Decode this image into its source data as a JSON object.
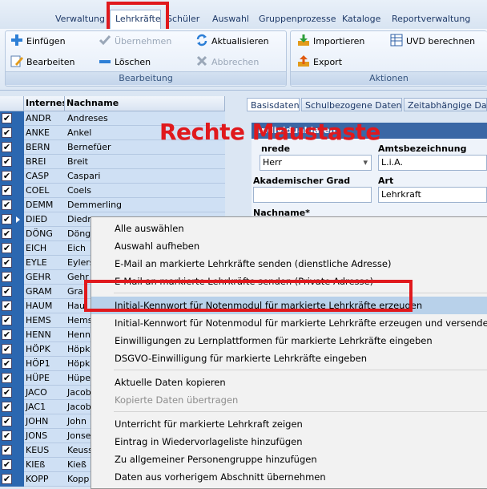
{
  "ribbon_tabs": [
    "Verwaltung",
    "Lehrkräfte",
    "Schüler",
    "Auswahl",
    "Gruppenprozesse",
    "Kataloge",
    "Reportverwaltung"
  ],
  "active_tab": "Lehrkräfte",
  "groups": {
    "bearbeitung": {
      "title": "Bearbeitung",
      "buttons": {
        "einfuegen": "Einfügen",
        "uebernehmen": "Übernehmen",
        "aktualisieren": "Aktualisieren",
        "bearbeiten": "Bearbeiten",
        "loeschen": "Löschen",
        "abbrechen": "Abbrechen"
      }
    },
    "aktionen": {
      "title": "Aktionen",
      "buttons": {
        "importieren": "Importieren",
        "uvd": "UVD berechnen",
        "export": "Export"
      }
    }
  },
  "grid": {
    "columns": [
      "Internes K",
      "Nachname"
    ],
    "rows": [
      {
        "kuerzel": "ANDR",
        "name": "Andreses"
      },
      {
        "kuerzel": "ANKE",
        "name": "Ankel"
      },
      {
        "kuerzel": "BERN",
        "name": "Bernefüer"
      },
      {
        "kuerzel": "BREI",
        "name": "Breit"
      },
      {
        "kuerzel": "CASP",
        "name": "Caspari"
      },
      {
        "kuerzel": "COEL",
        "name": "Coels"
      },
      {
        "kuerzel": "DEMM",
        "name": "Demmerling"
      },
      {
        "kuerzel": "DIED",
        "name": "Diedr"
      },
      {
        "kuerzel": "DÖNG",
        "name": "Döng"
      },
      {
        "kuerzel": "EICH",
        "name": "Eich"
      },
      {
        "kuerzel": "EYLE",
        "name": "Eylers"
      },
      {
        "kuerzel": "GEHR",
        "name": "Gehr"
      },
      {
        "kuerzel": "GRAM",
        "name": "Gra"
      },
      {
        "kuerzel": "HAUM",
        "name": "Hau"
      },
      {
        "kuerzel": "HEMS",
        "name": "Hems"
      },
      {
        "kuerzel": "HENN",
        "name": "Henn"
      },
      {
        "kuerzel": "HÖPK",
        "name": "Höpk"
      },
      {
        "kuerzel": "HÖP1",
        "name": "Höpk"
      },
      {
        "kuerzel": "HÜPE",
        "name": "Hüpe"
      },
      {
        "kuerzel": "JACO",
        "name": "Jacob"
      },
      {
        "kuerzel": "JAC1",
        "name": "Jacob"
      },
      {
        "kuerzel": "JOHN",
        "name": "John"
      },
      {
        "kuerzel": "JONS",
        "name": "Jonse"
      },
      {
        "kuerzel": "KEUS",
        "name": "Keuss"
      },
      {
        "kuerzel": "KIEß",
        "name": "Kieß"
      },
      {
        "kuerzel": "KOPP",
        "name": "Kopp"
      }
    ]
  },
  "detail_tabs": [
    "Basisdaten",
    "Schulbezogene Daten",
    "Zeitabhängige Date"
  ],
  "detail": {
    "header": "Individualdaten",
    "anrede_label": "nrede",
    "anrede_value": "Herr",
    "amtsbezeichnung_label": "Amtsbezeichnung",
    "amtsbezeichnung_value": "L.i.A.",
    "akad_grad_label": "Akademischer Grad",
    "art_label": "Art",
    "art_value": "Lehrkraft",
    "nachname_label": "Nachname*"
  },
  "overlay_text": "Rechte Maustaste",
  "context_menu": [
    {
      "label": "Alle auswählen",
      "enabled": true
    },
    {
      "label": "Auswahl aufheben",
      "enabled": true
    },
    {
      "label": "E-Mail an markierte Lehrkräfte senden (dienstliche Adresse)",
      "enabled": true
    },
    {
      "label": "E-Mail an markierte Lehrkräfte senden (Private Adresse)",
      "enabled": true
    },
    {
      "sep": true
    },
    {
      "label": "Initial-Kennwort für Notenmodul für markierte Lehrkräfte erzeugen",
      "enabled": true,
      "highlighted": true
    },
    {
      "label": "Initial-Kennwort für Notenmodul für markierte Lehrkräfte erzeugen und versenden",
      "enabled": true
    },
    {
      "label": "Einwilligungen zu Lernplattformen für markierte Lehrkräfte eingeben",
      "enabled": true
    },
    {
      "label": "DSGVO-Einwilligung für markierte Lehrkräfte eingeben",
      "enabled": true
    },
    {
      "sep": true
    },
    {
      "label": "Aktuelle Daten kopieren",
      "enabled": true
    },
    {
      "label": "Kopierte Daten übertragen",
      "enabled": false
    },
    {
      "sep": true
    },
    {
      "label": "Unterricht für markierte Lehrkraft zeigen",
      "enabled": true
    },
    {
      "label": "Eintrag in Wiedervorlageliste hinzufügen",
      "enabled": true
    },
    {
      "label": "Zu allgemeiner Personengruppe hinzufügen",
      "enabled": true
    },
    {
      "label": "Daten aus vorherigem Abschnitt übernehmen",
      "enabled": true
    }
  ],
  "colors": {
    "highlight_box": "#e0191d",
    "selection_column": "#2b67b0",
    "row_bg": "#cfe0f4",
    "menu_highlight": "#b8d1ea"
  }
}
